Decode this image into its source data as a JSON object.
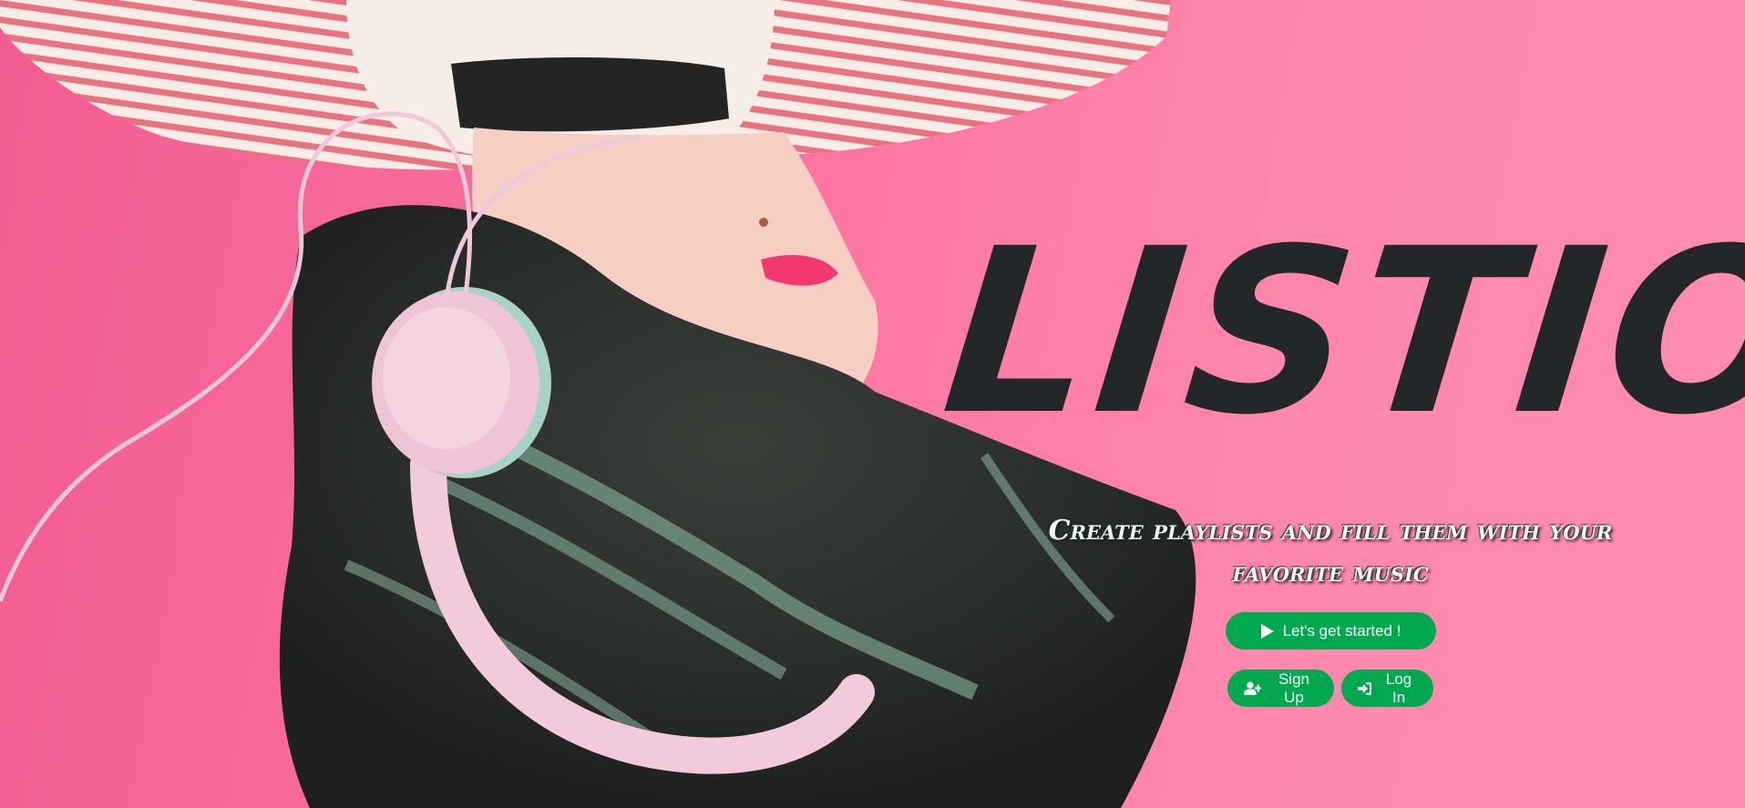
{
  "hero": {
    "title": "Listio",
    "tagline": "Create playlists and fill them with your favorite music",
    "background_colors": {
      "pink": "#ff86ad",
      "hair": "#2b2f2c",
      "hair_highlight": "#8fc4ad",
      "headphones": "#f3cadb",
      "skin": "#f6cfc2",
      "shirt_stripe": "#e9727f"
    }
  },
  "actions": {
    "start": {
      "label": "Let's get started !",
      "icon": "play-icon"
    },
    "signup": {
      "label": "Sign Up",
      "icon": "user-plus-icon"
    },
    "login": {
      "label": "Log In",
      "icon": "sign-in-icon"
    }
  },
  "colors": {
    "accent": "#00a94f",
    "title": "#24272a",
    "tagline": "#eafaf2"
  }
}
